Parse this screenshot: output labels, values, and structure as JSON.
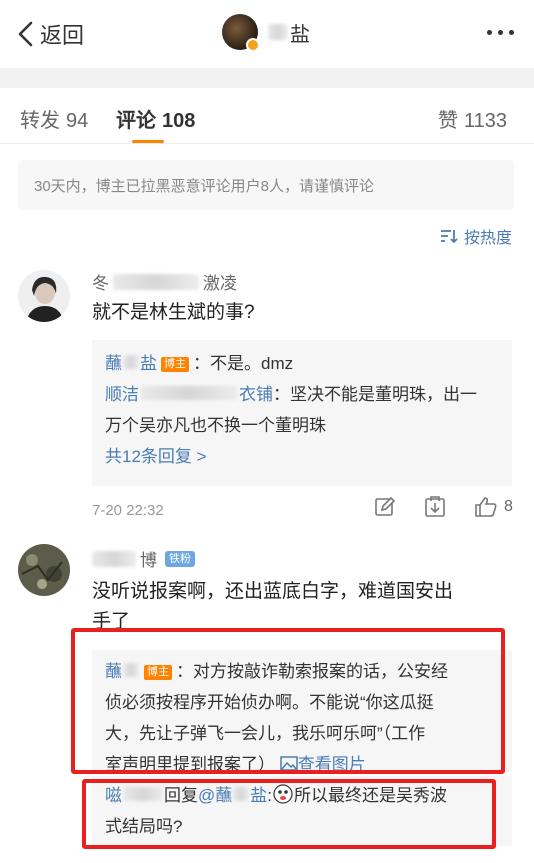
{
  "nav": {
    "back_label": "返回",
    "title_suffix": "盐"
  },
  "tabs": [
    {
      "label": "转发",
      "count": "94"
    },
    {
      "label": "评论",
      "count": "108"
    },
    {
      "label": "赞",
      "count": "1133"
    }
  ],
  "notice": "30天内，博主已拉黑恶意评论用户8人，请谨慎评论",
  "sort_label": "按热度",
  "comments": [
    {
      "name_prefix": "冬",
      "name_suffix": "激凌",
      "text": "就不是林生斌的事?",
      "replies": [
        {
          "user": "蘸",
          "user_suffix": "盐",
          "badge": "博主",
          "text": "：不是。dmz"
        },
        {
          "user": "顺洁",
          "user_suffix": "衣铺",
          "text_line1": "：坚决不能是董明珠，出一",
          "text_line2": "万个吴亦凡也不换一个董明珠"
        }
      ],
      "more_replies": "共12条回复 >",
      "time": "7-20 22:32",
      "likes": "8"
    },
    {
      "name_prefix": "",
      "name_suffix": "博",
      "fan_badge": "铁粉",
      "text_line1": "没听说报案啊，还出蓝底白字，难道国安出",
      "text_line2": "手了",
      "reply1": {
        "user": "蘸",
        "badge": "博主",
        "line1": "：对方按敲诈勒索报案的话，公安经",
        "line2": "侦必须按程序开始侦办啊。不能说“你这瓜挺",
        "line3": "大，先让子弹飞一会儿，我乐呵乐呵”（工作",
        "line4": "室声明里提到报案了）",
        "image_link": "查看图片"
      },
      "reply2": {
        "user": "嗞",
        "reply_word": "回复",
        "mention": "@蘸",
        "mention_suffix": "盐",
        "line1": "所以最终还是吴秀波",
        "line2": "式结局吗?"
      }
    }
  ],
  "colors": {
    "accent": "#ff8200",
    "link": "#4a7db5",
    "highlight": "#e8201f"
  }
}
